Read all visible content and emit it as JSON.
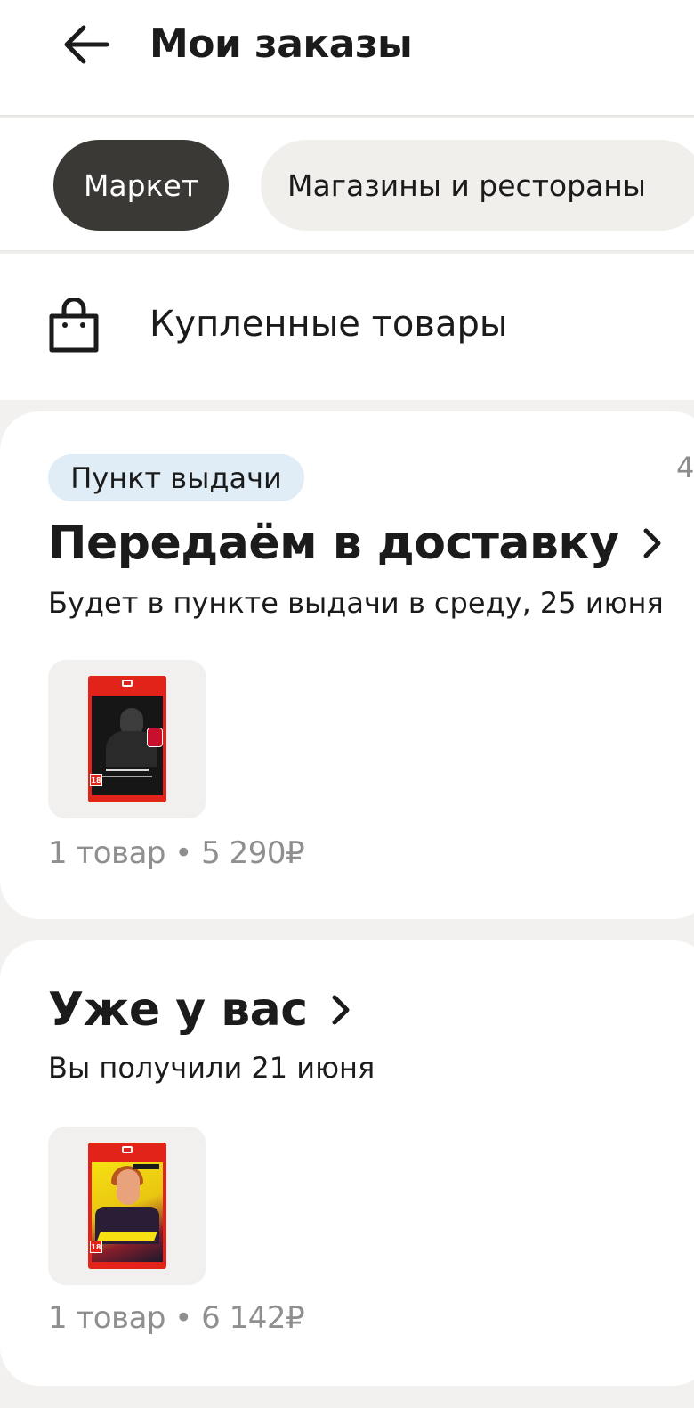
{
  "header": {
    "title": "Мои заказы"
  },
  "tabs": [
    {
      "label": "Маркет",
      "active": true
    },
    {
      "label": "Магазины и рестораны",
      "active": false
    }
  ],
  "purchased": {
    "label": "Купленные товары"
  },
  "orders": [
    {
      "badge": "Пункт выдачи",
      "edge_text": "4",
      "status": "Передаём в доставку",
      "subtitle": "Будет в пункте выдачи в среду, 25 июня",
      "summary": "1 товар • 5 290₽"
    },
    {
      "status": "Уже у вас",
      "subtitle": "Вы получили 21 июня",
      "summary": "1 товар • 6 142₽"
    }
  ],
  "colors": {
    "active_tab": "#3a3936",
    "badge_bg": "#e0edf6",
    "page_bg": "#f2f1ef"
  }
}
